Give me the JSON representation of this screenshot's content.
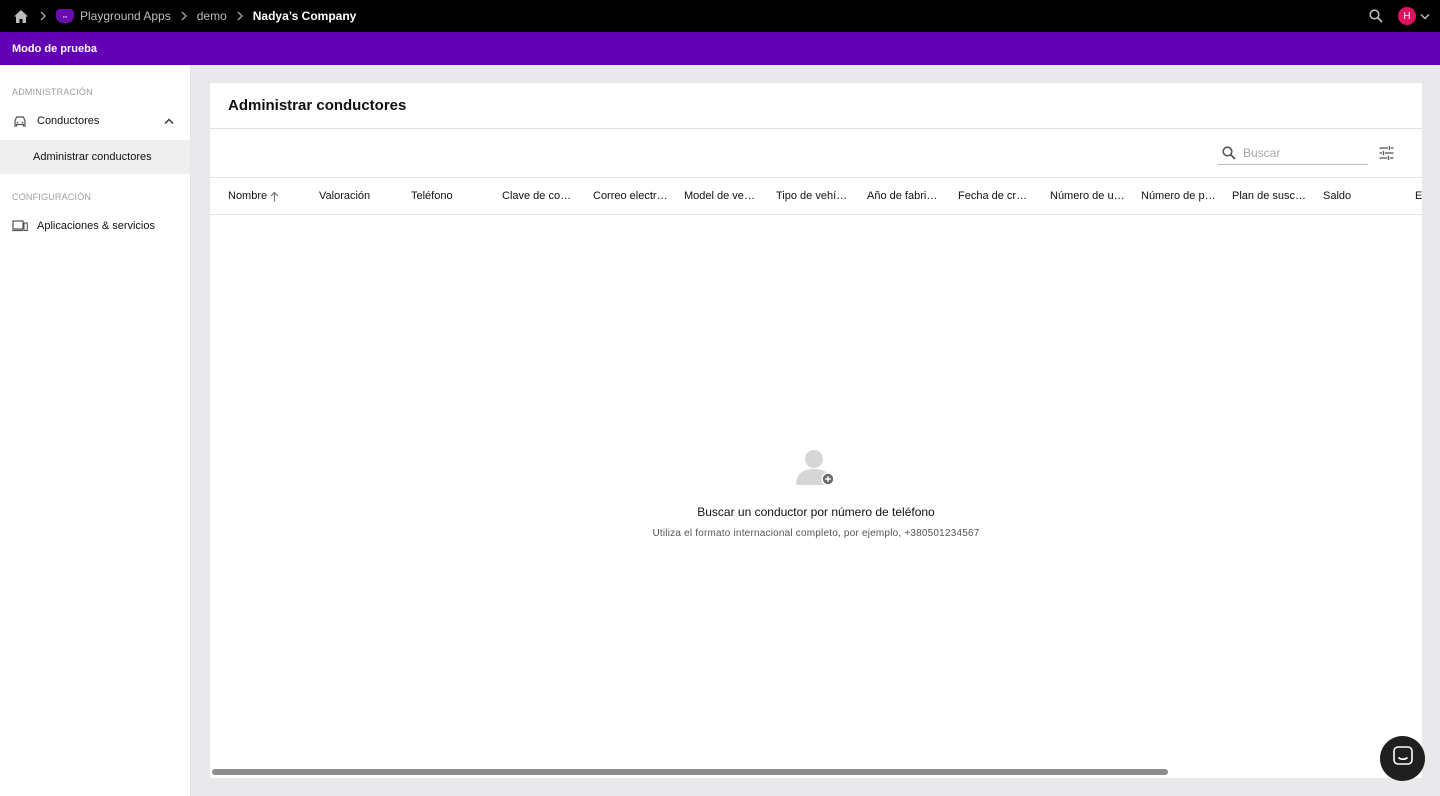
{
  "topbar": {
    "breadcrumbs": {
      "home_icon": "home-icon",
      "app": "Playground Apps",
      "project": "demo",
      "company": "Nadya’s Company"
    },
    "avatar_initial": "H",
    "search_icon": "search-icon"
  },
  "banner": {
    "text": "Modo de prueba"
  },
  "sidebar": {
    "admin_section": "ADMINISTRACIÓN",
    "drivers_label": "Conductores",
    "manage_drivers_label": "Administrar conductores",
    "config_section": "CONFIGURACIÓN",
    "apps_label": "Aplicaciones & servicios"
  },
  "main": {
    "title": "Administrar conductores",
    "search_placeholder": "Buscar",
    "columns": [
      "Nombre",
      "Valoración",
      "Teléfono",
      "Clave de conductor",
      "Correo electrónico",
      "Model de vehículo",
      "Tipo de vehículo",
      "Año de fabricación",
      "Fecha de creación",
      "Número de unidad",
      "Número de placa",
      "Plan de suscripción",
      "Saldo",
      "Estado"
    ],
    "sort_column": "Nombre",
    "sort_direction": "ascending",
    "empty_title": "Buscar un conductor por número de teléfono",
    "empty_subtitle": "Utiliza el formato internacional completo, por ejemplo, +380501234567"
  },
  "colors": {
    "topbar": "#000000",
    "banner": "#6200b3",
    "avatar": "#e0115f",
    "page_bg": "#e9e9eb"
  }
}
